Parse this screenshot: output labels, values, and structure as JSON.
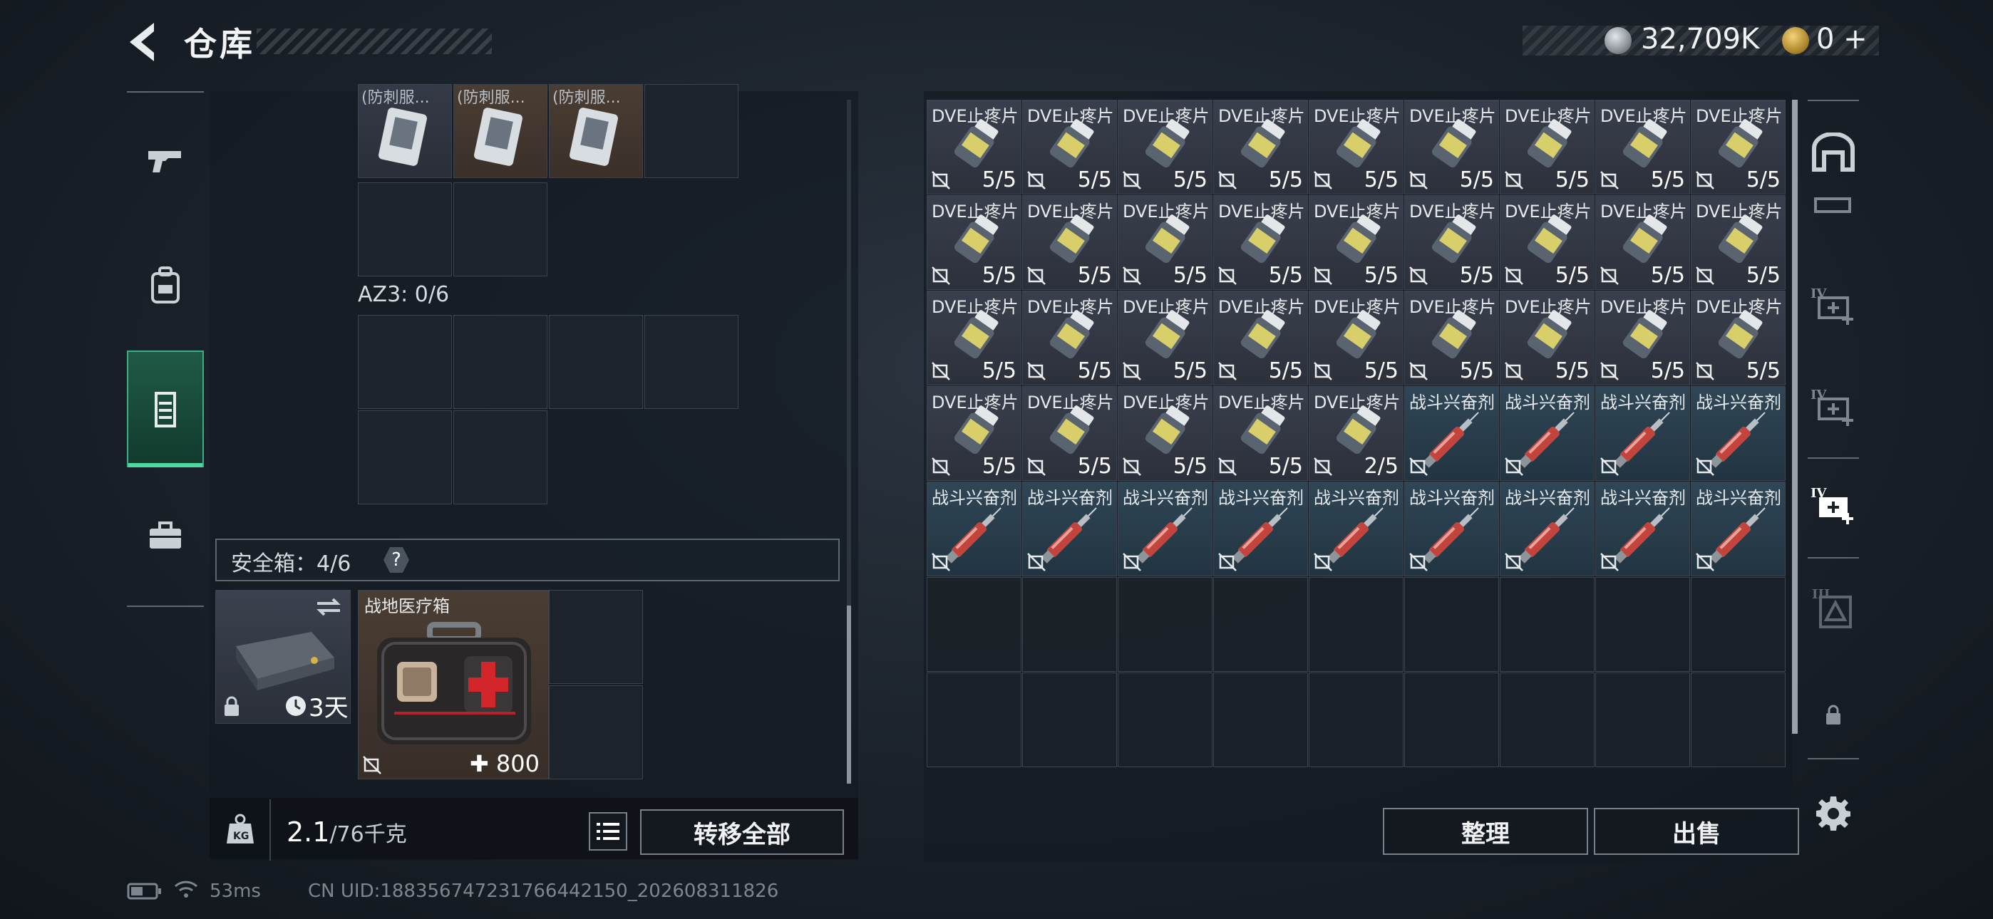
{
  "header": {
    "title": "仓库",
    "silver_amount": "32,709K",
    "gold_amount": "0",
    "gold_plus": "+"
  },
  "left_nav": [
    "weapon-tab",
    "backpack-tab",
    "chest-rig-tab",
    "toolbox-tab"
  ],
  "container_top": {
    "item_labels": [
      "(防刺服...",
      "(防刺服...",
      "(防刺服..."
    ]
  },
  "az3": {
    "label": "AZ3: 0/6"
  },
  "safe_box": {
    "label": "安全箱：4/6",
    "help": "?",
    "case_timer": "3天",
    "medkit_name": "战地医疗箱",
    "medkit_value": "800"
  },
  "weight": {
    "current": "2.1",
    "max": "/76千克"
  },
  "buttons": {
    "transfer_all": "转移全部",
    "sort": "整理",
    "sell": "出售"
  },
  "stash": {
    "pill_name": "DVE止疼片",
    "stim_name": "战斗兴奋剂",
    "rows": [
      [
        "5/5",
        "5/5",
        "5/5",
        "5/5",
        "5/5",
        "5/5",
        "5/5",
        "5/5",
        "5/5"
      ],
      [
        "5/5",
        "5/5",
        "5/5",
        "5/5",
        "5/5",
        "5/5",
        "5/5",
        "5/5",
        "5/5"
      ],
      [
        "5/5",
        "5/5",
        "5/5",
        "5/5",
        "5/5",
        "5/5",
        "5/5",
        "5/5",
        "5/5"
      ],
      [
        "5/5",
        "5/5",
        "5/5",
        "5/5",
        "2/5",
        "S",
        "S",
        "S",
        "S"
      ],
      [
        "S",
        "S",
        "S",
        "S",
        "S",
        "S",
        "S",
        "S",
        "S"
      ]
    ]
  },
  "status": {
    "ping": "53ms",
    "uid": "CN UID:1883567472317664421​50_202608311826"
  }
}
